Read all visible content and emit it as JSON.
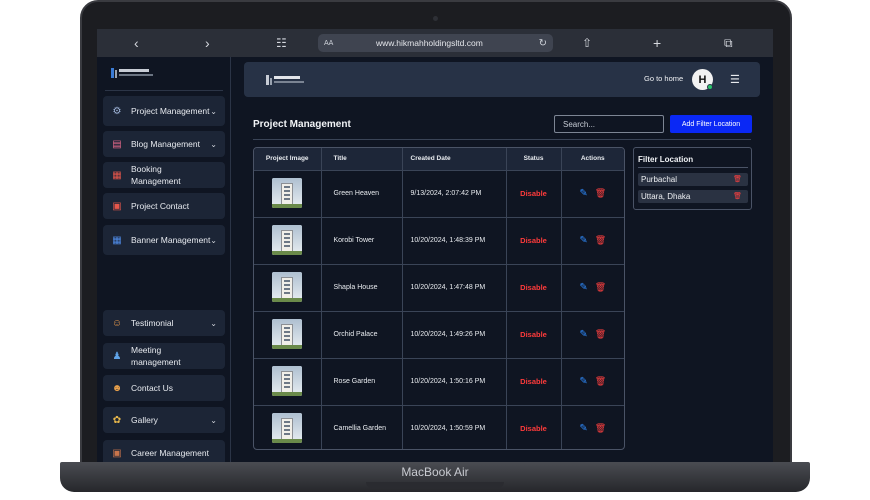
{
  "device": {
    "brand": "MacBook Air"
  },
  "browser": {
    "text_size_label": "AA",
    "url": "www.hikmahholdingsltd.com"
  },
  "sidebar": {
    "items": [
      {
        "label": "Project Management",
        "icon": "gear-icon",
        "has_chevron": true
      },
      {
        "label": "Blog Management",
        "icon": "blog-icon",
        "has_chevron": true
      },
      {
        "label": "Booking Management",
        "icon": "calendar-icon",
        "has_chevron": false
      },
      {
        "label": "Project Contact",
        "icon": "contact-card-icon",
        "has_chevron": false
      },
      {
        "label": "Banner Management",
        "icon": "image-icon",
        "has_chevron": true
      },
      {
        "label": "Testimonial",
        "icon": "person-comment-icon",
        "has_chevron": true
      },
      {
        "label": "Meeting management",
        "icon": "people-icon",
        "has_chevron": false
      },
      {
        "label": "Contact Us",
        "icon": "user-icon",
        "has_chevron": false
      },
      {
        "label": "Gallery",
        "icon": "gallery-icon",
        "has_chevron": true
      },
      {
        "label": "Career Management",
        "icon": "briefcase-icon",
        "has_chevron": false
      }
    ]
  },
  "header": {
    "go_home_label": "Go to home",
    "avatar_initial": "H"
  },
  "main": {
    "title": "Project Management",
    "search_placeholder": "Search...",
    "add_filter_label": "Add Filter Location",
    "table": {
      "headers": [
        "Project Image",
        "Title",
        "Created Date",
        "Status",
        "Actions"
      ],
      "rows": [
        {
          "title": "Green Heaven",
          "created": "9/13/2024, 2:07:42 PM",
          "status": "Disable"
        },
        {
          "title": "Korobi Tower",
          "created": "10/20/2024, 1:48:39 PM",
          "status": "Disable"
        },
        {
          "title": "Shapla House",
          "created": "10/20/2024, 1:47:48 PM",
          "status": "Disable"
        },
        {
          "title": "Orchid Palace",
          "created": "10/20/2024, 1:49:26 PM",
          "status": "Disable"
        },
        {
          "title": "Rose Garden",
          "created": "10/20/2024, 1:50:16 PM",
          "status": "Disable"
        },
        {
          "title": "Camellia Garden",
          "created": "10/20/2024, 1:50:59 PM",
          "status": "Disable"
        }
      ]
    }
  },
  "filter_panel": {
    "title": "Filter Location",
    "locations": [
      "Purbachal",
      "Uttara, Dhaka"
    ]
  },
  "colors": {
    "accent_blue": "#0a28f5",
    "status_red": "#ff3b3b",
    "background": "#0f1522"
  }
}
